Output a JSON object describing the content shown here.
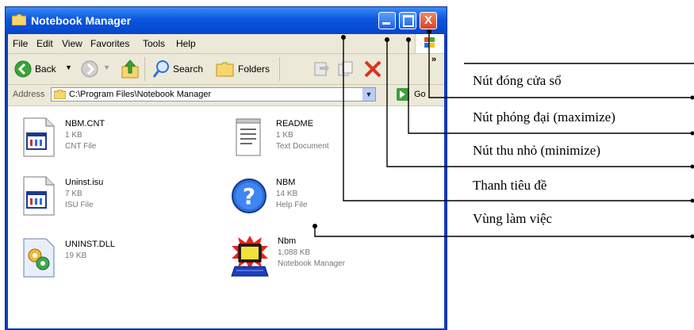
{
  "window": {
    "title": "Notebook Manager",
    "close_symbol": "X"
  },
  "menu": [
    "File",
    "Edit",
    "View",
    "Favorites",
    "Tools",
    "Help"
  ],
  "toolbar": {
    "back": "Back",
    "search": "Search",
    "folders": "Folders"
  },
  "address": {
    "label": "Address",
    "value": "C:\\Program Files\\Notebook Manager",
    "go": "Go",
    "overflow": "»"
  },
  "files": [
    {
      "name": "NBM.CNT",
      "size": "1 KB",
      "type": "CNT File",
      "icon": "cnt-file-icon"
    },
    {
      "name": "README",
      "size": "1 KB",
      "type": "Text Document",
      "icon": "text-document-icon"
    },
    {
      "name": "Uninst.isu",
      "size": "7 KB",
      "type": "ISU File",
      "icon": "isu-file-icon"
    },
    {
      "name": "NBM",
      "size": "14 KB",
      "type": "Help File",
      "icon": "help-file-icon"
    },
    {
      "name": "UNINST.DLL",
      "size": "19 KB",
      "type": "",
      "icon": "dll-file-icon"
    },
    {
      "name": "Nbm",
      "size": "1,088 KB",
      "type": "Notebook Manager",
      "icon": "application-icon"
    }
  ],
  "callouts": {
    "close": "Nút đóng cửa sổ",
    "maximize": "Nút phóng đại (maximize)",
    "minimize": "Nút thu nhỏ (minimize)",
    "titlebar": "Thanh tiêu đề",
    "workarea": "Vùng làm việc"
  },
  "colors": {
    "titlebar": "#0b55e0",
    "close_button": "#d5432a",
    "chrome": "#ece9d8"
  }
}
